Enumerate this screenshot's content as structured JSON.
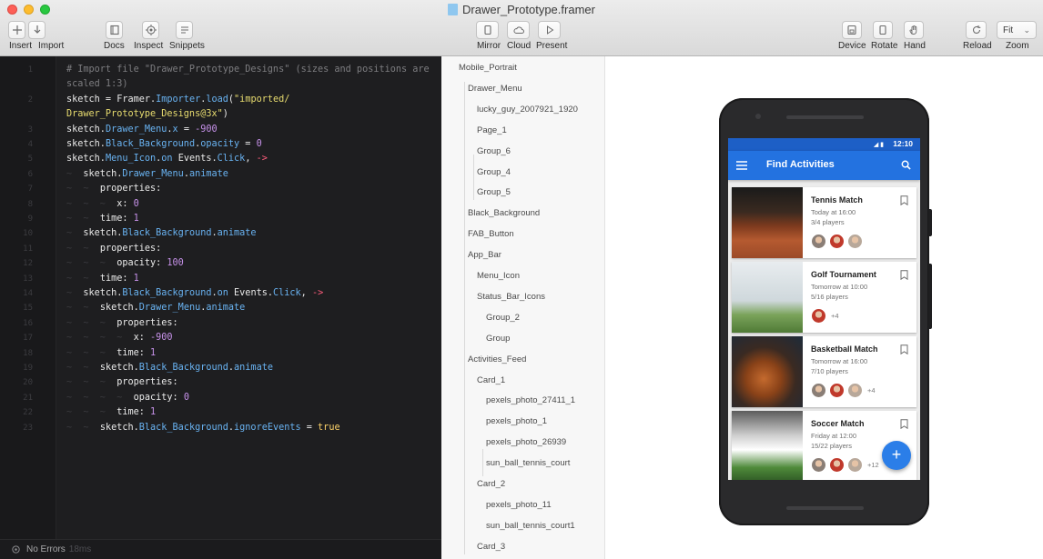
{
  "window": {
    "title": "Drawer_Prototype.framer",
    "toolbar_left": [
      {
        "id": "insert",
        "label": "Insert",
        "icon": "plus-icon"
      },
      {
        "id": "import",
        "label": "Import",
        "icon": "download-icon"
      },
      {
        "id": "docs",
        "label": "Docs",
        "icon": "book-icon"
      },
      {
        "id": "inspect",
        "label": "Inspect",
        "icon": "target-icon"
      },
      {
        "id": "snippets",
        "label": "Snippets",
        "icon": "snippet-icon"
      }
    ],
    "toolbar_center": [
      {
        "id": "mirror",
        "label": "Mirror",
        "icon": "mirror-icon"
      },
      {
        "id": "cloud",
        "label": "Cloud",
        "icon": "cloud-icon"
      },
      {
        "id": "present",
        "label": "Present",
        "icon": "play-icon"
      }
    ],
    "toolbar_right": [
      {
        "id": "device",
        "label": "Device",
        "icon": "device-icon"
      },
      {
        "id": "rotate",
        "label": "Rotate",
        "icon": "rotate-icon"
      },
      {
        "id": "hand",
        "label": "Hand",
        "icon": "hand-icon"
      },
      {
        "id": "reload",
        "label": "Reload",
        "icon": "reload-icon"
      },
      {
        "id": "zoom",
        "label": "Zoom",
        "icon": "zoom-select",
        "value": "Fit"
      }
    ]
  },
  "editor": {
    "lines": [
      {
        "n": "1",
        "tokens": [
          [
            "comment",
            "# Import file \"Drawer_Prototype_Designs\" (sizes and positions are"
          ]
        ]
      },
      {
        "n": "",
        "tokens": [
          [
            "comment",
            "scaled 1:3)"
          ]
        ]
      },
      {
        "n": "2",
        "tokens": [
          [
            "plain",
            "sketch = Framer."
          ],
          [
            "method",
            "Importer"
          ],
          [
            "plain",
            "."
          ],
          [
            "method",
            "load"
          ],
          [
            "plain",
            "("
          ],
          [
            "string",
            "\"imported/"
          ]
        ]
      },
      {
        "n": "",
        "tokens": [
          [
            "string",
            "Drawer_Prototype_Designs@3x\""
          ],
          [
            "plain",
            ")"
          ]
        ]
      },
      {
        "n": "3",
        "tokens": [
          [
            "plain",
            "sketch."
          ],
          [
            "method",
            "Drawer_Menu"
          ],
          [
            "plain",
            "."
          ],
          [
            "method",
            "x"
          ],
          [
            "plain",
            " = "
          ],
          [
            "number",
            "-900"
          ]
        ]
      },
      {
        "n": "4",
        "tokens": [
          [
            "plain",
            "sketch."
          ],
          [
            "method",
            "Black_Background"
          ],
          [
            "plain",
            "."
          ],
          [
            "method",
            "opacity"
          ],
          [
            "plain",
            " = "
          ],
          [
            "number",
            "0"
          ]
        ]
      },
      {
        "n": "5",
        "tokens": [
          [
            "plain",
            "sketch."
          ],
          [
            "method",
            "Menu_Icon"
          ],
          [
            "plain",
            "."
          ],
          [
            "method",
            "on"
          ],
          [
            "plain",
            " Events."
          ],
          [
            "method",
            "Click"
          ],
          [
            "plain",
            ", "
          ],
          [
            "arrow",
            "->"
          ]
        ]
      },
      {
        "n": "6",
        "tokens": [
          [
            "indent",
            "~  "
          ],
          [
            "plain",
            "sketch."
          ],
          [
            "method",
            "Drawer_Menu"
          ],
          [
            "plain",
            "."
          ],
          [
            "method",
            "animate"
          ]
        ]
      },
      {
        "n": "7",
        "tokens": [
          [
            "indent",
            "~  ~  "
          ],
          [
            "plain",
            "properties:"
          ]
        ]
      },
      {
        "n": "8",
        "tokens": [
          [
            "indent",
            "~  ~  ~  "
          ],
          [
            "plain",
            "x: "
          ],
          [
            "number",
            "0"
          ]
        ]
      },
      {
        "n": "9",
        "tokens": [
          [
            "indent",
            "~  ~  "
          ],
          [
            "plain",
            "time: "
          ],
          [
            "number",
            "1"
          ]
        ]
      },
      {
        "n": "10",
        "tokens": [
          [
            "indent",
            "~  "
          ],
          [
            "plain",
            "sketch."
          ],
          [
            "method",
            "Black_Background"
          ],
          [
            "plain",
            "."
          ],
          [
            "method",
            "animate"
          ]
        ]
      },
      {
        "n": "11",
        "tokens": [
          [
            "indent",
            "~  ~  "
          ],
          [
            "plain",
            "properties:"
          ]
        ]
      },
      {
        "n": "12",
        "tokens": [
          [
            "indent",
            "~  ~  ~  "
          ],
          [
            "plain",
            "opacity: "
          ],
          [
            "number",
            "100"
          ]
        ]
      },
      {
        "n": "13",
        "tokens": [
          [
            "indent",
            "~  ~  "
          ],
          [
            "plain",
            "time: "
          ],
          [
            "number",
            "1"
          ]
        ]
      },
      {
        "n": "14",
        "tokens": [
          [
            "indent",
            "~  "
          ],
          [
            "plain",
            "sketch."
          ],
          [
            "method",
            "Black_Background"
          ],
          [
            "plain",
            "."
          ],
          [
            "method",
            "on"
          ],
          [
            "plain",
            " Events."
          ],
          [
            "method",
            "Click"
          ],
          [
            "plain",
            ", "
          ],
          [
            "arrow",
            "->"
          ]
        ]
      },
      {
        "n": "15",
        "tokens": [
          [
            "indent",
            "~  ~  "
          ],
          [
            "plain",
            "sketch."
          ],
          [
            "method",
            "Drawer_Menu"
          ],
          [
            "plain",
            "."
          ],
          [
            "method",
            "animate"
          ]
        ]
      },
      {
        "n": "16",
        "tokens": [
          [
            "indent",
            "~  ~  ~  "
          ],
          [
            "plain",
            "properties:"
          ]
        ]
      },
      {
        "n": "17",
        "tokens": [
          [
            "indent",
            "~  ~  ~  ~  "
          ],
          [
            "plain",
            "x: "
          ],
          [
            "number",
            "-900"
          ]
        ]
      },
      {
        "n": "18",
        "tokens": [
          [
            "indent",
            "~  ~  ~  "
          ],
          [
            "plain",
            "time: "
          ],
          [
            "number",
            "1"
          ]
        ]
      },
      {
        "n": "19",
        "tokens": [
          [
            "indent",
            "~  ~  "
          ],
          [
            "plain",
            "sketch."
          ],
          [
            "method",
            "Black_Background"
          ],
          [
            "plain",
            "."
          ],
          [
            "method",
            "animate"
          ]
        ]
      },
      {
        "n": "20",
        "tokens": [
          [
            "indent",
            "~  ~  ~  "
          ],
          [
            "plain",
            "properties:"
          ]
        ]
      },
      {
        "n": "21",
        "tokens": [
          [
            "indent",
            "~  ~  ~  ~  "
          ],
          [
            "plain",
            "opacity: "
          ],
          [
            "number",
            "0"
          ]
        ]
      },
      {
        "n": "22",
        "tokens": [
          [
            "indent",
            "~  ~  ~  "
          ],
          [
            "plain",
            "time: "
          ],
          [
            "number",
            "1"
          ]
        ]
      },
      {
        "n": "23",
        "tokens": [
          [
            "indent",
            "~  ~  "
          ],
          [
            "plain",
            "sketch."
          ],
          [
            "method",
            "Black_Background"
          ],
          [
            "plain",
            "."
          ],
          [
            "method",
            "ignoreEvents"
          ],
          [
            "plain",
            " = "
          ],
          [
            "bool",
            "true"
          ]
        ]
      }
    ],
    "status": {
      "text": "No Errors",
      "timing": "18ms"
    }
  },
  "layers": [
    {
      "name": "Mobile_Portrait",
      "depth": 0
    },
    {
      "name": "Drawer_Menu",
      "depth": 1
    },
    {
      "name": "lucky_guy_2007921_1920",
      "depth": 2
    },
    {
      "name": "Page_1",
      "depth": 2
    },
    {
      "name": "Group_6",
      "depth": 2
    },
    {
      "name": "Group_4",
      "depth": 2
    },
    {
      "name": "Group_5",
      "depth": 2
    },
    {
      "name": "Black_Background",
      "depth": 1
    },
    {
      "name": "FAB_Button",
      "depth": 1
    },
    {
      "name": "App_Bar",
      "depth": 1
    },
    {
      "name": "Menu_Icon",
      "depth": 2
    },
    {
      "name": "Status_Bar_Icons",
      "depth": 2
    },
    {
      "name": "Group_2",
      "depth": 3
    },
    {
      "name": "Group",
      "depth": 3
    },
    {
      "name": "Activities_Feed",
      "depth": 1
    },
    {
      "name": "Card_1",
      "depth": 2
    },
    {
      "name": "pexels_photo_27411_1",
      "depth": 3
    },
    {
      "name": "pexels_photo_1",
      "depth": 3
    },
    {
      "name": "pexels_photo_26939",
      "depth": 3
    },
    {
      "name": "sun_ball_tennis_court",
      "depth": 3
    },
    {
      "name": "Card_2",
      "depth": 2
    },
    {
      "name": "pexels_photo_11",
      "depth": 3
    },
    {
      "name": "sun_ball_tennis_court1",
      "depth": 3
    },
    {
      "name": "Card_3",
      "depth": 2
    }
  ],
  "app": {
    "status_time": "12:10",
    "title": "Find Activities",
    "fab_label": "+",
    "cards": [
      {
        "title": "Tennis Match",
        "time": "Today at 16:00",
        "players": "3/4 players",
        "avatars": 3,
        "more": ""
      },
      {
        "title": "Golf Tournament",
        "time": "Tomorrow at 10:00",
        "players": "5/16 players",
        "avatars": 1,
        "more": "+4"
      },
      {
        "title": "Basketball Match",
        "time": "Tomorrow at 16:00",
        "players": "7/10 players",
        "avatars": 3,
        "more": "+4"
      },
      {
        "title": "Soccer Match",
        "time": "Friday at 12:00",
        "players": "15/22 players",
        "avatars": 3,
        "more": "+12"
      }
    ]
  },
  "colors": {
    "app_bar": "#2372e0",
    "status_bar": "#1d5fc6",
    "fab": "#2b7ee8",
    "editor_bg": "#1e1e20"
  }
}
